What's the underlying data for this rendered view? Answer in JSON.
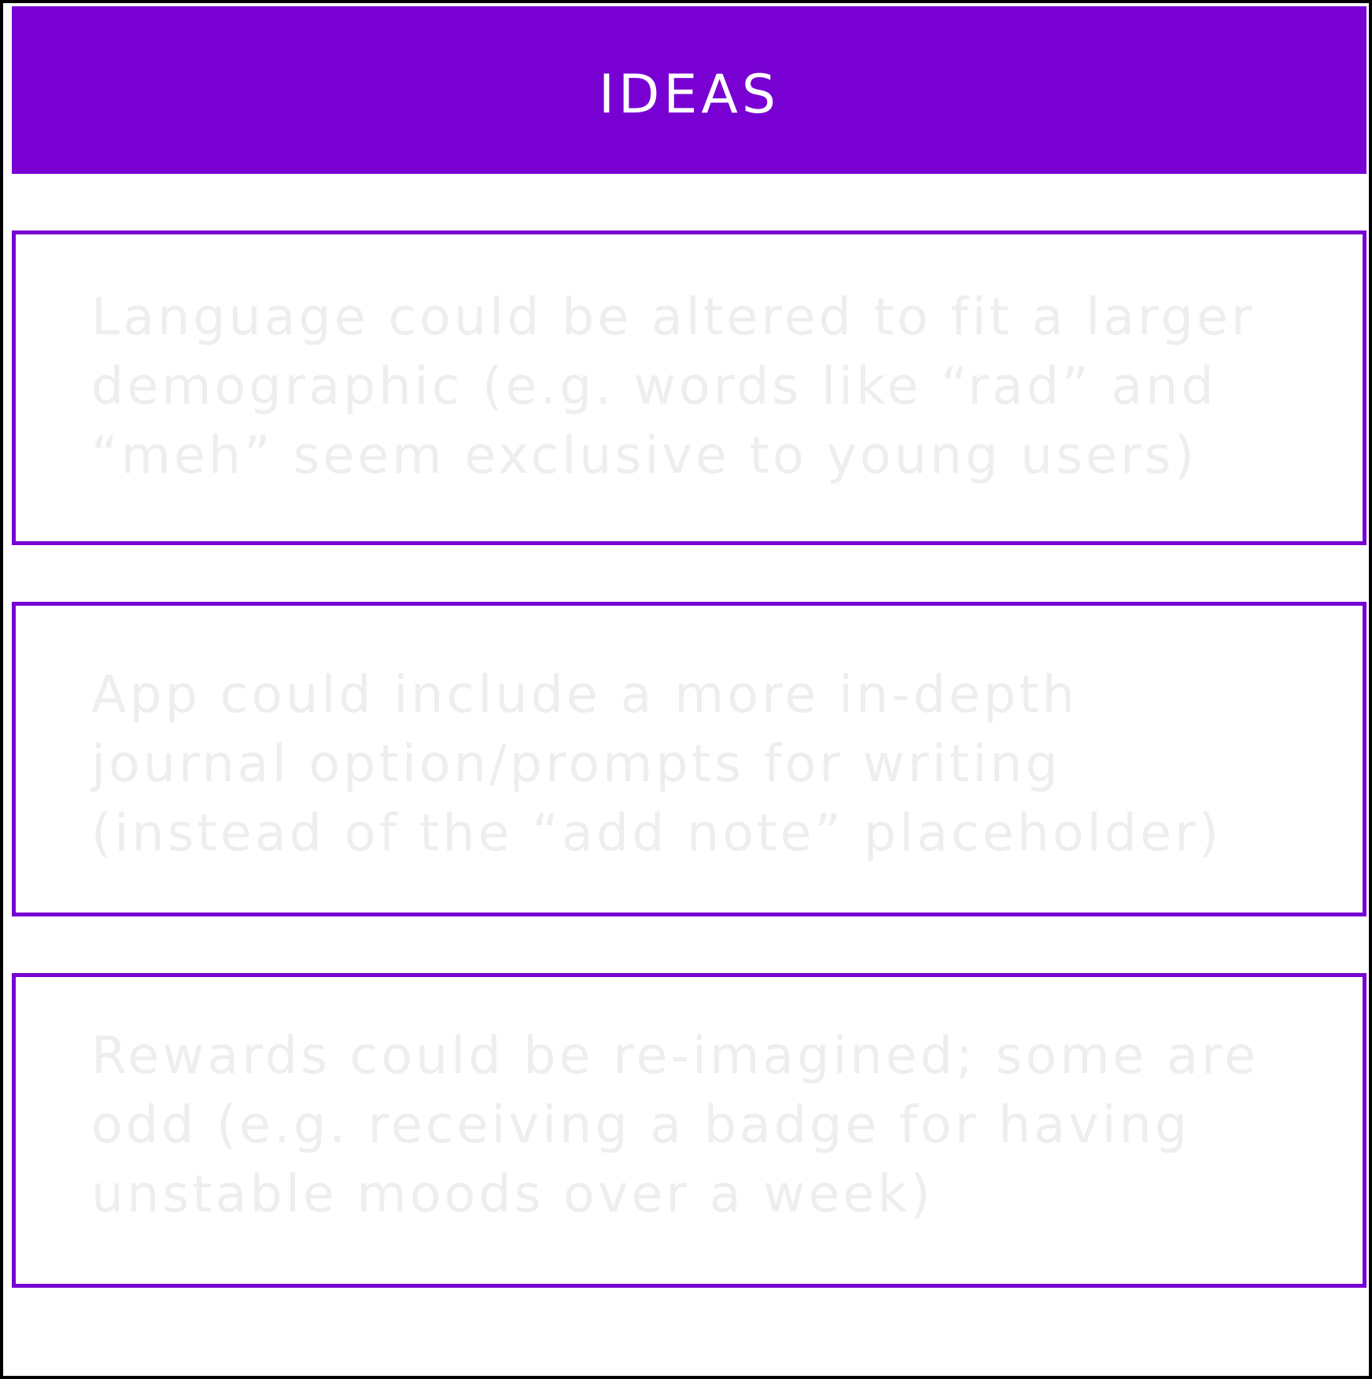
{
  "header": {
    "title": "IDEAS"
  },
  "ideas": [
    {
      "text": "Language could be altered to fit a larger demographic (e.g. words like “rad” and “meh” seem exclusive to young users)"
    },
    {
      "text": "App could include a more in-depth journal option/prompts for writing (instead of the “add note” placeholder)"
    },
    {
      "text": "Rewards could be re-imagined; some are odd (e.g. receiving a badge for having unstable moods over a week)"
    }
  ],
  "colors": {
    "accent": "#7800d2",
    "frame": "#000000",
    "header_text": "#ffffff",
    "idea_text": "#eeeeee"
  }
}
